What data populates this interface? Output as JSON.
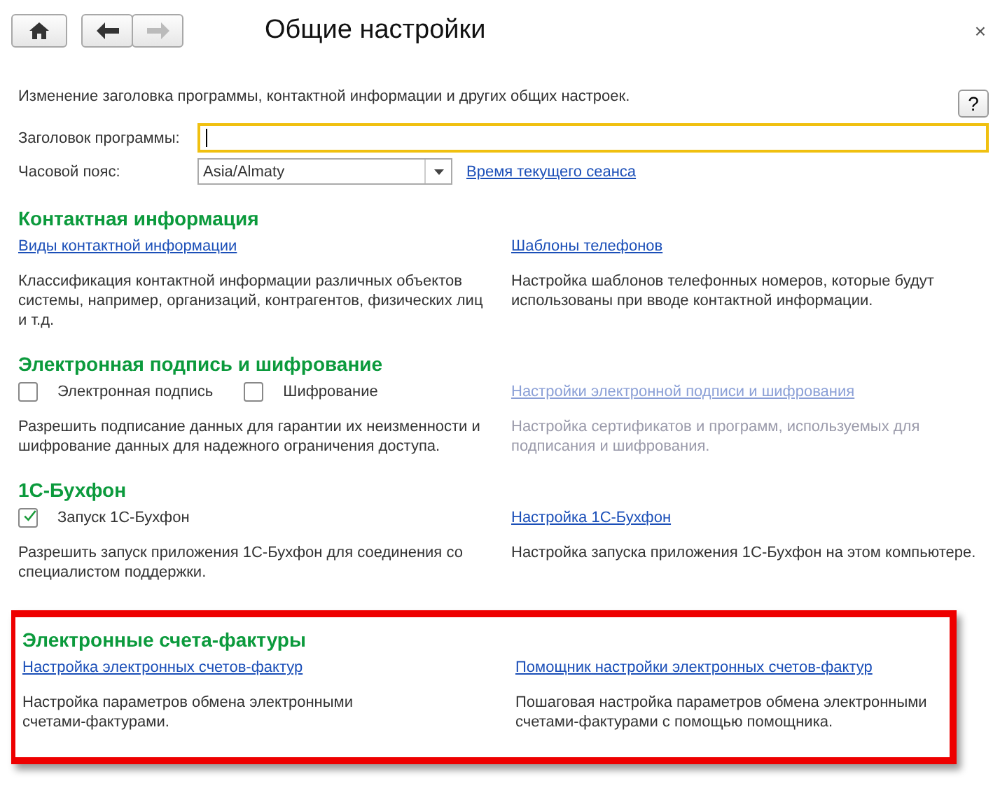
{
  "window": {
    "title": "Общие настройки",
    "close": "×"
  },
  "nav": {
    "back_enabled": true,
    "forward_enabled": false
  },
  "intro": "Изменение заголовка программы, контактной информации и других общих настроек.",
  "help": "?",
  "fields": [
    {
      "label": "Заголовок программы:",
      "kind": "text",
      "focused": true
    },
    {
      "label": "Часовой пояс:",
      "kind": "select",
      "value": "Asia/Almaty",
      "link": "Время текущего сеанса"
    }
  ],
  "sections": [
    {
      "title": "Контактная информация",
      "highlighted": false,
      "left": {
        "link": "Виды контактной информации",
        "description": [
          "Классификация контактной информации различных объектов",
          "системы, например, организаций, контрагентов, физических лиц",
          "и т.д."
        ]
      },
      "right": {
        "link": "Шаблоны телефонов",
        "disabled": false,
        "description": [
          "Настройка шаблонов телефонных номеров, которые будут",
          "использованы при вводе контактной информации."
        ]
      }
    },
    {
      "title": "Электронная подпись и шифрование",
      "highlighted": false,
      "left": {
        "checkboxes": [
          {
            "label": "Электронная подпись",
            "checked": false
          },
          {
            "label": "Шифрование",
            "checked": false
          }
        ],
        "description": [
          "Разрешить подписание данных для гарантии их неизменности и",
          "шифрование данных для надежного ограничения доступа."
        ]
      },
      "right": {
        "link": "Настройки электронной подписи и шифрования",
        "disabled": true,
        "description": [
          "Настройка сертификатов и программ, используемых для",
          "подписания и шифрования."
        ]
      }
    },
    {
      "title": "1С-Бухфон",
      "highlighted": false,
      "left": {
        "checkboxes": [
          {
            "label": "Запуск 1С-Бухфон",
            "checked": true
          }
        ],
        "description": [
          "Разрешить запуск приложения 1С-Бухфон для соединения со",
          "специалистом поддержки."
        ]
      },
      "right": {
        "link": "Настройка 1С-Бухфон",
        "disabled": false,
        "description": [
          "Настройка запуска приложения 1С-Бухфон на этом компьютере."
        ]
      }
    },
    {
      "title": "Электронные счета-фактуры",
      "highlighted": true,
      "left": {
        "link": "Настройка электронных счетов-фактур",
        "description": [
          "Настройка параметров обмена электронными",
          "счетами-фактурами."
        ]
      },
      "right": {
        "link": "Помощник настройки электронных счетов-фактур",
        "disabled": false,
        "description": [
          "Пошаговая настройка параметров обмена электронными",
          "счетами-фактурами с помощью помощника."
        ]
      }
    }
  ]
}
